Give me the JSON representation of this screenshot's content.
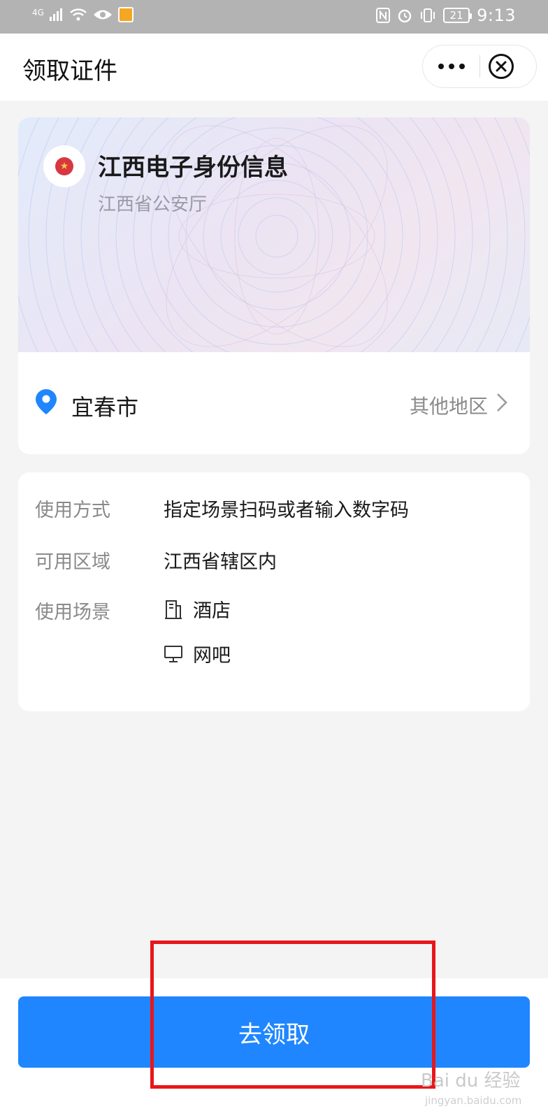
{
  "status_bar": {
    "network": "4G",
    "battery": "21",
    "time": "9:13"
  },
  "nav": {
    "title": "领取证件"
  },
  "card": {
    "title": "江西电子身份信息",
    "issuer": "江西省公安厅",
    "city": "宜春市",
    "other_region_label": "其他地区"
  },
  "info": {
    "usage_method_label": "使用方式",
    "usage_method_value": "指定场景扫码或者输入数字码",
    "area_label": "可用区域",
    "area_value": "江西省辖区内",
    "scene_label": "使用场景",
    "scenes": [
      {
        "icon": "hotel-icon",
        "label": "酒店"
      },
      {
        "icon": "computer-icon",
        "label": "网吧"
      }
    ]
  },
  "action": {
    "button_label": "去领取"
  },
  "colors": {
    "primary": "#1f86ff",
    "highlight": "#e8161b",
    "pin": "#1f86ff"
  },
  "watermark": {
    "brand": "Bai du 经验",
    "url": "jingyan.baidu.com"
  }
}
